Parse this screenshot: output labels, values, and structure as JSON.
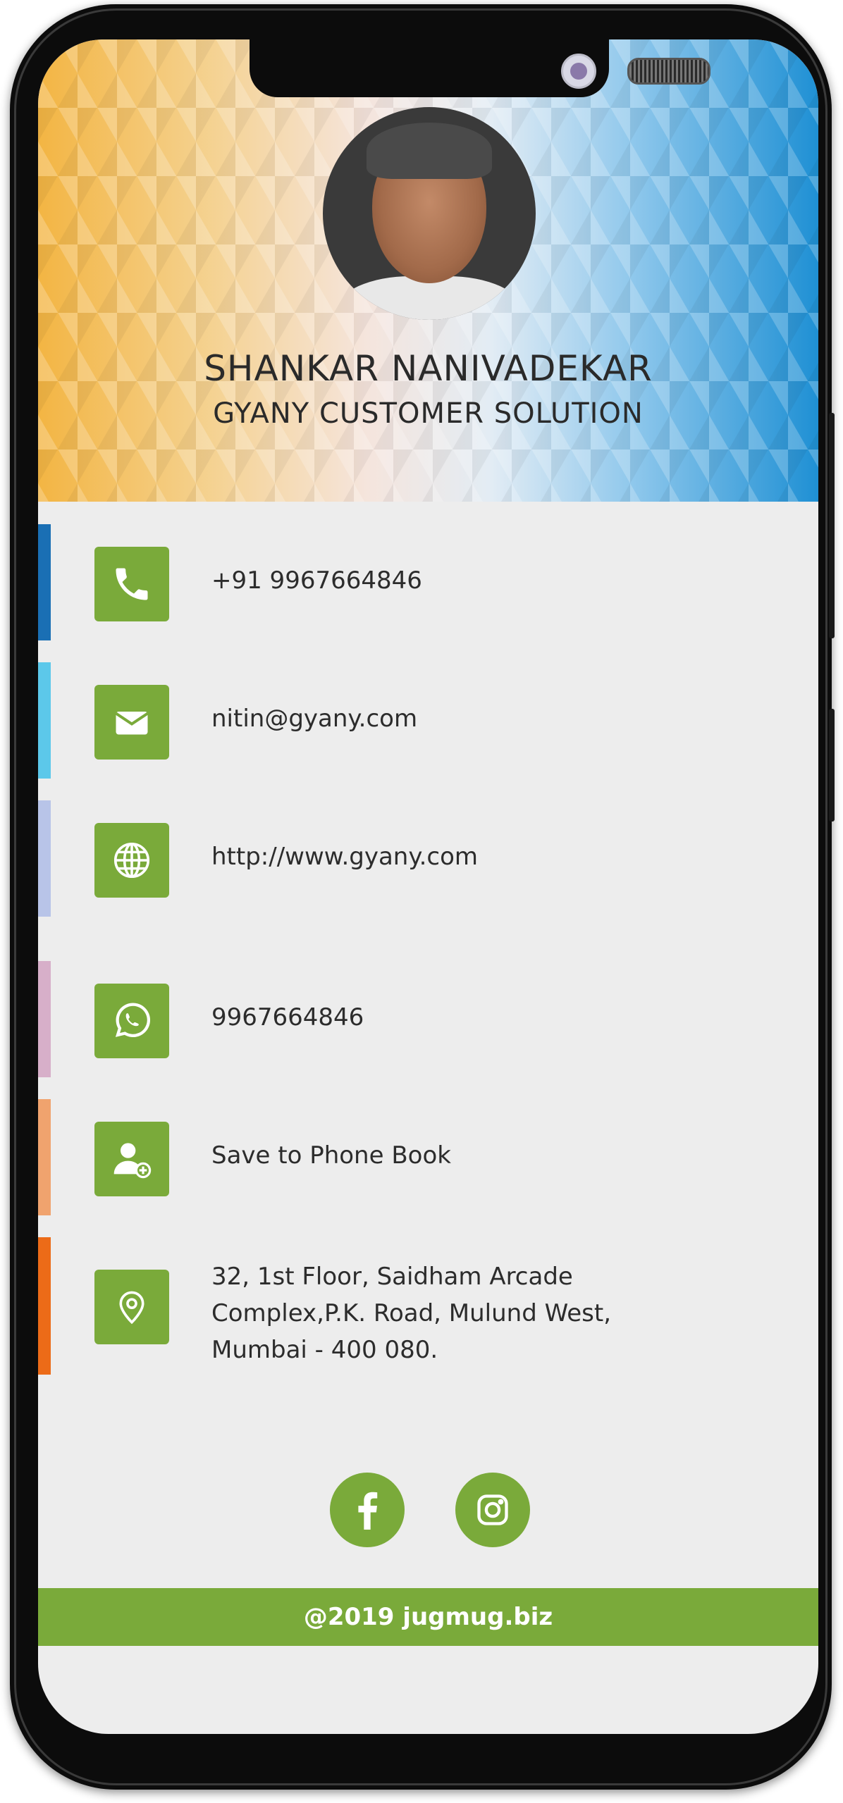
{
  "profile": {
    "name": "SHANKAR NANIVADEKAR",
    "company": "GYANY CUSTOMER SOLUTION"
  },
  "contacts": [
    {
      "icon": "phone-icon",
      "text": "+91 9967664846",
      "stripe": "#1a6fb4"
    },
    {
      "icon": "email-icon",
      "text": "nitin@gyany.com",
      "stripe": "#5cc8ea"
    },
    {
      "icon": "globe-icon",
      "text": "http://www.gyany.com",
      "stripe": "#b8c4e8"
    },
    {
      "icon": "whatsapp-icon",
      "text": "9967664846",
      "stripe": "#d7afc9"
    },
    {
      "icon": "add-contact-icon",
      "text": "Save to Phone Book",
      "stripe": "#f0a36e"
    },
    {
      "icon": "location-pin-icon",
      "text": "32, 1st Floor, Saidham Arcade Complex,P.K. Road, Mulund West, Mumbai - 400 080.",
      "stripe": "#ec6b18"
    }
  ],
  "address_lines": [
    "32, 1st Floor, Saidham Arcade",
    "Complex,P.K. Road, Mulund West,",
    "Mumbai - 400 080."
  ],
  "social": [
    {
      "icon": "facebook-icon"
    },
    {
      "icon": "instagram-icon"
    }
  ],
  "footer": {
    "text": "@2019 jugmug.biz"
  },
  "colors": {
    "accent": "#7aaa3a"
  }
}
